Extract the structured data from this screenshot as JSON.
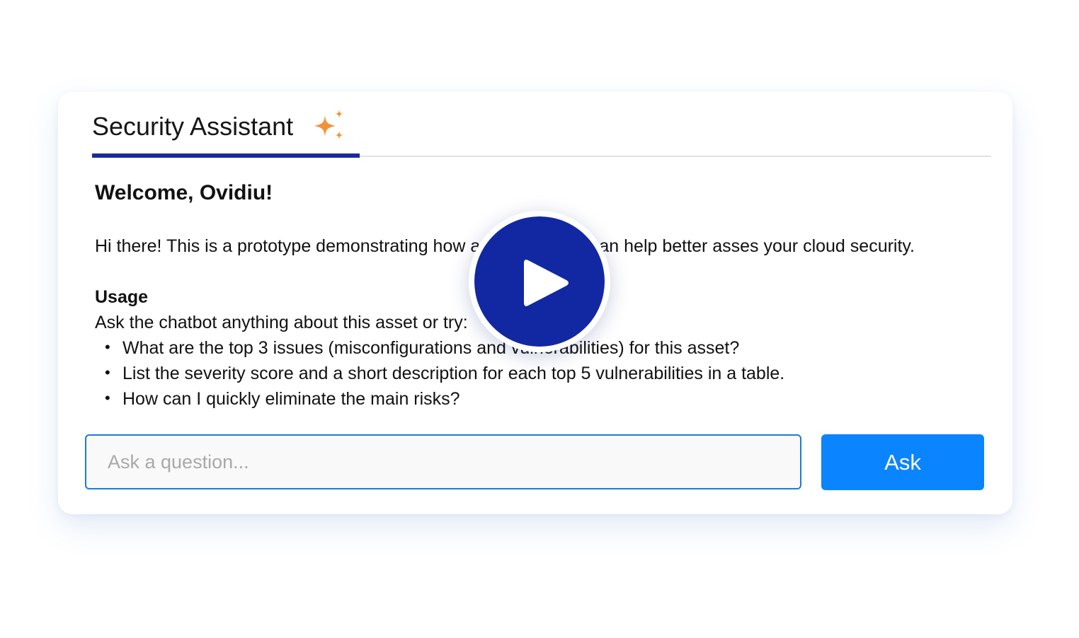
{
  "colors": {
    "accent": "#1a2a9e",
    "sparkle": "#f0923b",
    "input_border": "#1f7ad6",
    "button": "#0a84ff",
    "play_button": "#1128a2"
  },
  "assistant": {
    "tab_label": "Security Assistant",
    "tab_icon": "sparkles-icon"
  },
  "message": {
    "welcome": "Welcome, Ovidiu!",
    "intro": "Hi there! This is a prototype demonstrating how an AI assistant can help better asses your cloud security.",
    "usage_heading": "Usage",
    "usage_text": "Ask the chatbot anything about this asset or try:",
    "suggestions": [
      "What are the top 3 issues (misconfigurations and vulnerabilities) for this asset?",
      "List the severity score and a short description for each top 5 vulnerabilities in a table.",
      "How can I quickly eliminate the main risks?"
    ]
  },
  "composer": {
    "placeholder": "Ask a question...",
    "ask_label": "Ask"
  },
  "overlay": {
    "icon": "play-icon"
  }
}
